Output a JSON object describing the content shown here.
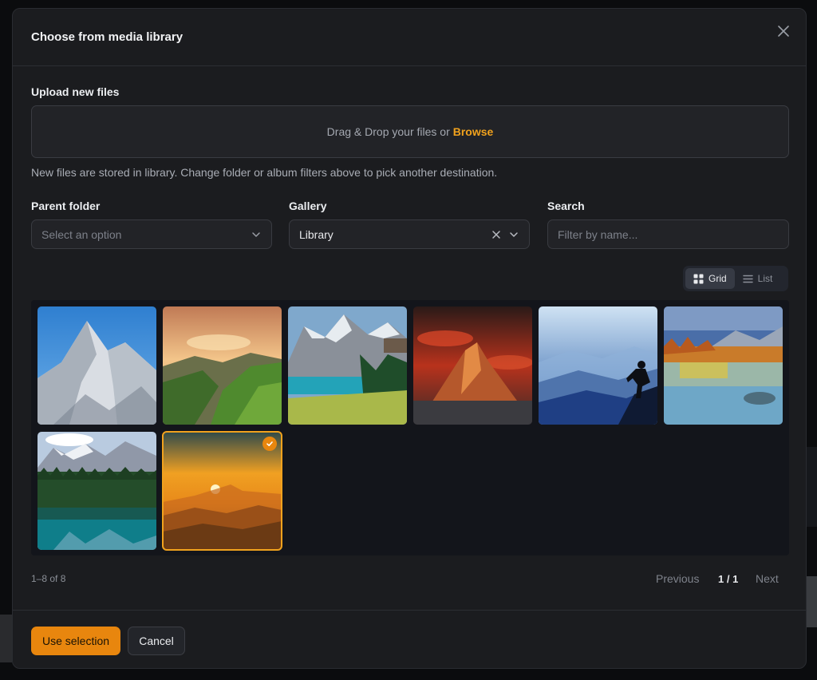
{
  "modal": {
    "title": "Choose from media library",
    "close_icon": "close-icon"
  },
  "upload": {
    "label": "Upload new files",
    "drop_text": "Drag & Drop your files or",
    "browse_label": "Browse",
    "helper": "New files are stored in library. Change folder or album filters above to pick another destination."
  },
  "filters": {
    "parent_folder": {
      "label": "Parent folder",
      "placeholder": "Select an option"
    },
    "gallery": {
      "label": "Gallery",
      "value": "Library"
    },
    "search": {
      "label": "Search",
      "placeholder": "Filter by name..."
    }
  },
  "view_toggle": {
    "grid_label": "Grid",
    "list_label": "List",
    "active": "grid"
  },
  "images": [
    {
      "name": "snowy-peak",
      "selected": false
    },
    {
      "name": "valley-sunset",
      "selected": false
    },
    {
      "name": "alpine-lake",
      "selected": false
    },
    {
      "name": "red-matterhorn",
      "selected": false
    },
    {
      "name": "hiker-silhouette",
      "selected": false
    },
    {
      "name": "autumn-lake",
      "selected": false
    },
    {
      "name": "forest-lake",
      "selected": false
    },
    {
      "name": "sunset-mountains",
      "selected": true
    }
  ],
  "pagination": {
    "count": "1–8 of 8",
    "previous_label": "Previous",
    "page": "1 / 1",
    "next_label": "Next"
  },
  "footer": {
    "use_selection_label": "Use selection",
    "cancel_label": "Cancel"
  },
  "colors": {
    "accent": "#f1a21d",
    "primary_button": "#e8860e",
    "modal_bg": "#1b1c1f",
    "gallery_bg": "#13151b"
  }
}
